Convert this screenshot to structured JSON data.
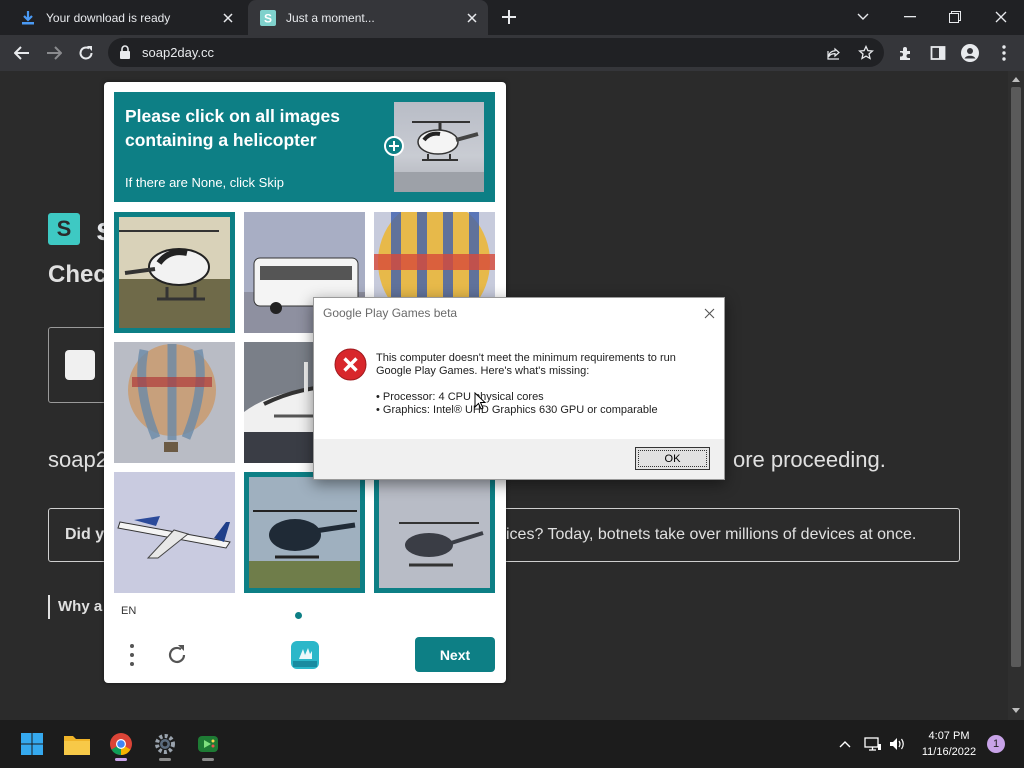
{
  "browser": {
    "tabs": [
      {
        "title": "Your download is ready",
        "favicon": "download-arrow-icon"
      },
      {
        "title": "Just a moment...",
        "favicon": "soap2day-favicon"
      }
    ],
    "address": "soap2day.cc"
  },
  "page": {
    "logo_letter": "S",
    "site_name": "s",
    "checking_text": "Check",
    "review_start": "soap2",
    "review_end": "ore proceeding.",
    "info_question": "Did yo",
    "info_rest": "ices? Today, botnets take over millions of devices at once.",
    "why_text": "Why a"
  },
  "captcha": {
    "prompt": "Please click on all images containing a helicopter",
    "subprompt": "If there are None, click Skip",
    "language": "EN",
    "next_label": "Next",
    "accent": "#0d7f85",
    "cells": [
      {
        "content": "helicopter",
        "selected": true
      },
      {
        "content": "bus",
        "selected": false
      },
      {
        "content": "hot-air-balloon",
        "selected": false
      },
      {
        "content": "hot-air-balloon",
        "selected": false
      },
      {
        "content": "yacht",
        "selected": false
      },
      {
        "content": "hidden",
        "selected": false
      },
      {
        "content": "airplane",
        "selected": false
      },
      {
        "content": "helicopter",
        "selected": true
      },
      {
        "content": "helicopter",
        "selected": true
      }
    ]
  },
  "dialog": {
    "title": "Google Play Games beta",
    "message_1": "This computer doesn't meet the minimum requirements to run",
    "message_2": "Google Play Games. Here's what's missing:",
    "item_1": "• Processor: 4 CPU physical cores",
    "item_2": "• Graphics: Intel® UHD Graphics 630 GPU or comparable",
    "ok_label": "OK"
  },
  "taskbar": {
    "time": "4:07 PM",
    "date": "11/16/2022",
    "notification_count": "1"
  }
}
